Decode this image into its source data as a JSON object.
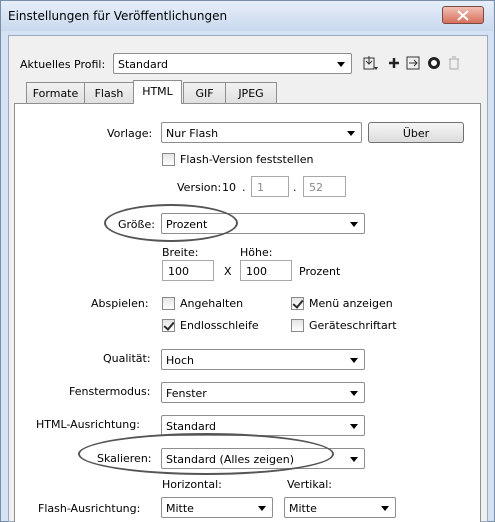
{
  "window": {
    "title": "Einstellungen für Veröffentlichungen"
  },
  "profile": {
    "label": "Aktuelles Profil:",
    "value": "Standard"
  },
  "toolbar": {
    "icons": [
      "import-export-icon",
      "add-icon",
      "duplicate-icon",
      "info-icon",
      "delete-icon"
    ]
  },
  "tabs": [
    {
      "label": "Formate"
    },
    {
      "label": "Flash"
    },
    {
      "label": "HTML",
      "active": true
    },
    {
      "label": "GIF"
    },
    {
      "label": "JPEG"
    }
  ],
  "html_tab": {
    "template": {
      "label": "Vorlage:",
      "value": "Nur Flash",
      "info_button": "Über"
    },
    "detect_flash": {
      "label": "Flash-Version feststellen",
      "checked": false
    },
    "version": {
      "label": "Version:",
      "major": "10",
      "sep1": ".",
      "minor": "1",
      "sep2": ".",
      "revision": "52"
    },
    "size": {
      "label": "Größe:",
      "value": "Prozent",
      "width_label": "Breite:",
      "height_label": "Höhe:",
      "width": "100",
      "x": "X",
      "height": "100",
      "unit": "Prozent"
    },
    "playback": {
      "label": "Abspielen:",
      "paused": {
        "label": "Angehalten",
        "checked": false
      },
      "show_menu": {
        "label": "Menü anzeigen",
        "checked": true
      },
      "loop": {
        "label": "Endlosschleife",
        "checked": true
      },
      "device_font": {
        "label": "Geräteschriftart",
        "checked": false
      }
    },
    "quality": {
      "label": "Qualität:",
      "value": "Hoch"
    },
    "window_mode": {
      "label": "Fenstermodus:",
      "value": "Fenster"
    },
    "html_alignment": {
      "label": "HTML-Ausrichtung:",
      "value": "Standard"
    },
    "scale": {
      "label": "Skalieren:",
      "value": "Standard (Alles zeigen)"
    },
    "flash_alignment": {
      "label": "Flash-Ausrichtung:",
      "horizontal_label": "Horizontal:",
      "vertical_label": "Vertikal:",
      "horizontal": "Mitte",
      "vertical": "Mitte"
    }
  },
  "colors": {
    "window_frame": "#d4e2f4",
    "close_button": "#d8705c",
    "annotation_oval": "#555555"
  }
}
